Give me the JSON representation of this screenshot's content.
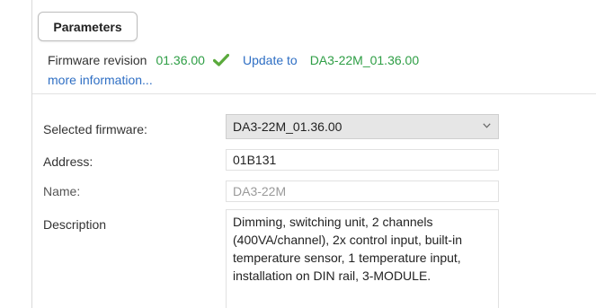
{
  "parameters_tab": {
    "label": "Parameters"
  },
  "firmware": {
    "label": "Firmware revision",
    "version": "01.36.00",
    "update_label": "Update to",
    "update_target": "DA3-22M_01.36.00",
    "more_info": "more information...",
    "status_icon": "check-icon",
    "colors": {
      "ok": "#2e9e45",
      "link": "#2f6fc4"
    }
  },
  "fields": {
    "selected_firmware": {
      "label": "Selected firmware:",
      "value": "DA3-22M_01.36.00"
    },
    "address": {
      "label": "Address:",
      "value": "01B131"
    },
    "name": {
      "label": "Name:",
      "placeholder": "DA3-22M"
    },
    "description": {
      "label": "Description",
      "value": "Dimming, switching unit, 2 channels (400VA/channel), 2x control input, built-in temperature sensor, 1 temperature input, installation on DIN rail, 3-MODULE."
    }
  }
}
